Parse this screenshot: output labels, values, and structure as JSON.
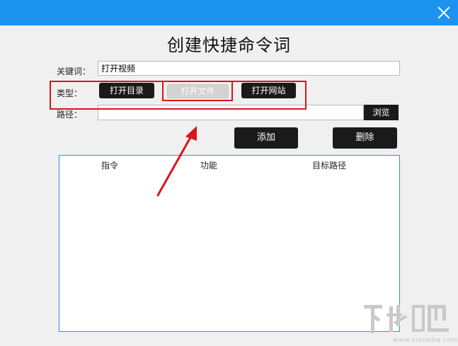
{
  "window": {
    "close_icon": "close-icon"
  },
  "title": "创建快捷命令词",
  "keyword": {
    "label": "关键词：",
    "value": "打开视频"
  },
  "type": {
    "label": "类型：",
    "options": [
      {
        "label": "打开目录",
        "state": "normal"
      },
      {
        "label": "打开文件",
        "state": "selected-disabled"
      },
      {
        "label": "打开网站",
        "state": "normal"
      }
    ]
  },
  "path": {
    "label": "路径：",
    "value": "",
    "browse_label": "浏览"
  },
  "actions": {
    "add_label": "添加",
    "delete_label": "删除"
  },
  "table": {
    "columns": [
      "指令",
      "功能",
      "目标路径"
    ],
    "rows": []
  },
  "watermark": {
    "text": "下载吧",
    "url": "www.xiazaiba.com"
  },
  "colors": {
    "titlebar": "#1b93ef",
    "annotation": "#d8151b",
    "button_dark": "#1a1a1a",
    "table_border": "#2d8ee6"
  }
}
